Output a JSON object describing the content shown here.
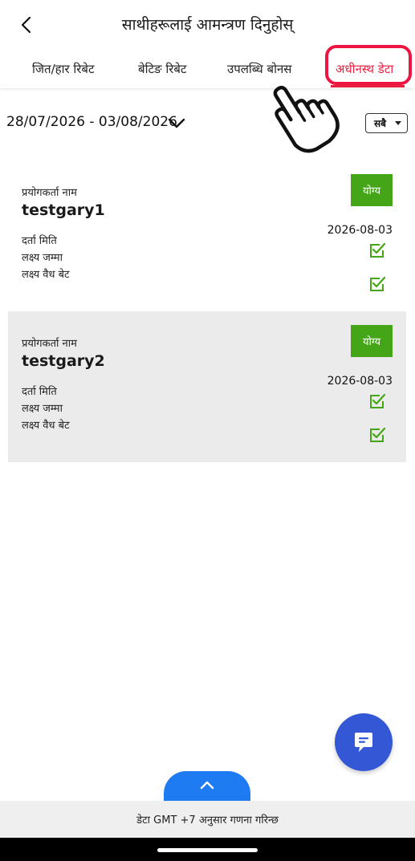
{
  "header": {
    "title": "साथीहरूलाई आमन्त्रण दिनुहोस्"
  },
  "tabs": [
    {
      "label": "जित/हार रिबेट",
      "active": false
    },
    {
      "label": "बेटिङ रिबेट",
      "active": false
    },
    {
      "label": "उपलब्धि बोनस",
      "active": false
    },
    {
      "label": "अधीनस्थ डेटा",
      "active": true
    }
  ],
  "filter": {
    "date_range": "28/07/2026 - 03/08/2026",
    "select_value": "सबै"
  },
  "cards": [
    {
      "user_label": "प्रयोगकर्ता नाम",
      "username": "testgary1",
      "badge": "योग्य",
      "reg_label": "दर्ता मिति",
      "reg_date": "2026-08-03",
      "deposit_label": "लक्ष्य जम्मा",
      "deposit_met": true,
      "bet_label": "लक्ष्य वैध बेट",
      "bet_met": true
    },
    {
      "user_label": "प्रयोगकर्ता नाम",
      "username": "testgary2",
      "badge": "योग्य",
      "reg_label": "दर्ता मिति",
      "reg_date": "2026-08-03",
      "deposit_label": "लक्ष्य जम्मा",
      "deposit_met": true,
      "bet_label": "लक्ष्य वैध बेट",
      "bet_met": true
    }
  ],
  "footer": {
    "note": "डेटा GMT +7 अनुसार गणना गरिन्छ"
  },
  "colors": {
    "accent_red": "#e8203f",
    "highlight_red": "#ee1543",
    "badge_green": "#44a616",
    "check_green": "#44a616",
    "fab_blue": "#3457d6",
    "scroll_blue": "#1f7bf2"
  },
  "icons": [
    "back-arrow-icon",
    "chevron-down-icon",
    "caret-down-icon",
    "pointing-hand-icon",
    "check-box-icon",
    "chat-bubble-icon",
    "chevron-up-icon"
  ]
}
